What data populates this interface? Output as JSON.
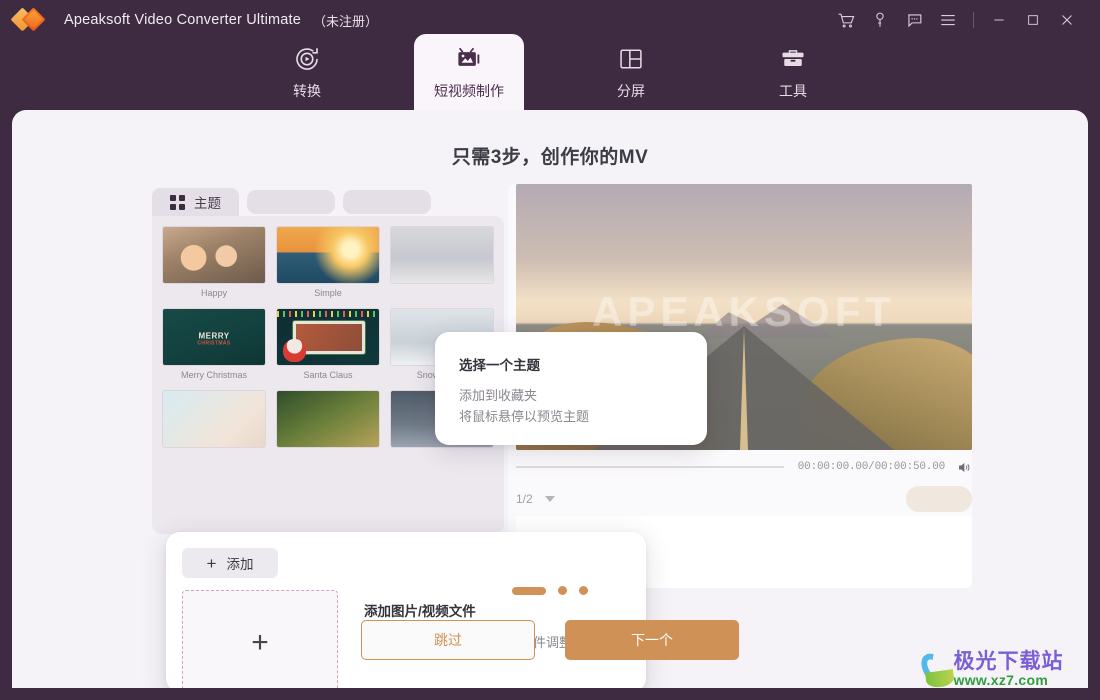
{
  "window": {
    "title": "Apeaksoft Video Converter Ultimate",
    "unregistered": "（未注册）",
    "logo_icon": "apeaksoft-diamond-logo",
    "controls": [
      {
        "name": "cart-icon",
        "glyph": "cart"
      },
      {
        "name": "key-icon",
        "glyph": "key"
      },
      {
        "name": "feedback-icon",
        "glyph": "chat"
      },
      {
        "name": "menu-icon",
        "glyph": "hamburger"
      },
      {
        "name": "minimize-icon",
        "glyph": "minimize"
      },
      {
        "name": "maximize-icon",
        "glyph": "maximize"
      },
      {
        "name": "close-icon",
        "glyph": "close"
      }
    ]
  },
  "nav": {
    "tabs": [
      {
        "label": "转换",
        "icon": "convert-icon",
        "active": false
      },
      {
        "label": "短视频制作",
        "icon": "mv-icon",
        "active": true
      },
      {
        "label": "分屏",
        "icon": "collage-icon",
        "active": false
      },
      {
        "label": "工具",
        "icon": "toolbox-icon",
        "active": false
      }
    ]
  },
  "main": {
    "page_title": "只需3步，创作你的MV",
    "theme_tabs": [
      {
        "label": "主题",
        "icon": "grid-icon",
        "active": true
      },
      {
        "label": "",
        "icon": "",
        "active": false
      },
      {
        "label": "",
        "icon": "",
        "active": false
      }
    ],
    "themes": [
      {
        "name": "Happy",
        "art": "art-happy"
      },
      {
        "name": "Simple",
        "art": "art-simple"
      },
      {
        "name": "",
        "art": "art-moon"
      },
      {
        "name": "Merry Christmas",
        "art": "art-xmas"
      },
      {
        "name": "Santa Claus",
        "art": "art-santa"
      },
      {
        "name": "Snowy Night",
        "art": "art-snowy"
      },
      {
        "name": "",
        "art": "art-baby"
      },
      {
        "name": "",
        "art": "art-tree"
      },
      {
        "name": "",
        "art": "art-night"
      }
    ],
    "preview": {
      "watermark_text": "APEAKSOFT",
      "timecode": "00:00:00.00/00:00:50.00",
      "volume_icon": "speaker-icon",
      "page_indicator": "1/2",
      "dropdown_icon": "chevron-down-icon"
    },
    "tooltip_theme": {
      "title": "选择一个主题",
      "line1": "添加到收藏夹",
      "line2": "将鼠标悬停以预览主题"
    },
    "tooltip_add": {
      "add_button": "添加",
      "plus_icon": "plus-icon",
      "dropzone_icon": "plus-icon",
      "title": "添加图片/视频文件",
      "subtitle": "添加文件成功后，可以拖动文件调整顺序"
    },
    "pagination": {
      "total": 3,
      "active_index": 0
    },
    "footer": {
      "skip": "跳过",
      "next": "下一个"
    }
  },
  "watermark": {
    "site_name": "极光下载站",
    "url": "www.xz7.com",
    "icon": "aurora-swirl-logo"
  },
  "colors": {
    "chrome": "#3e2b42",
    "content_bg": "#f5f3f7",
    "accent": "#cf9155",
    "accent_logo": "#f0952f"
  }
}
